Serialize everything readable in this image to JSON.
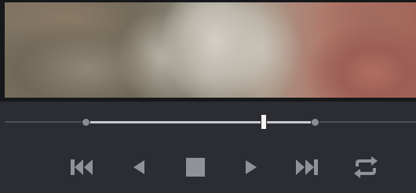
{
  "viewer": {
    "accent_color": "#c7c9ce",
    "icon_color": "#8f9297",
    "playback_position": 0.78
  },
  "transport": {
    "buttons": [
      {
        "name": "go-to-start",
        "icon": "skip-to-start-icon"
      },
      {
        "name": "play-reverse",
        "icon": "play-reverse-icon"
      },
      {
        "name": "stop",
        "icon": "stop-icon"
      },
      {
        "name": "play-forward",
        "icon": "play-icon"
      },
      {
        "name": "go-to-end",
        "icon": "skip-to-end-icon"
      },
      {
        "name": "loop",
        "icon": "loop-icon"
      }
    ]
  }
}
